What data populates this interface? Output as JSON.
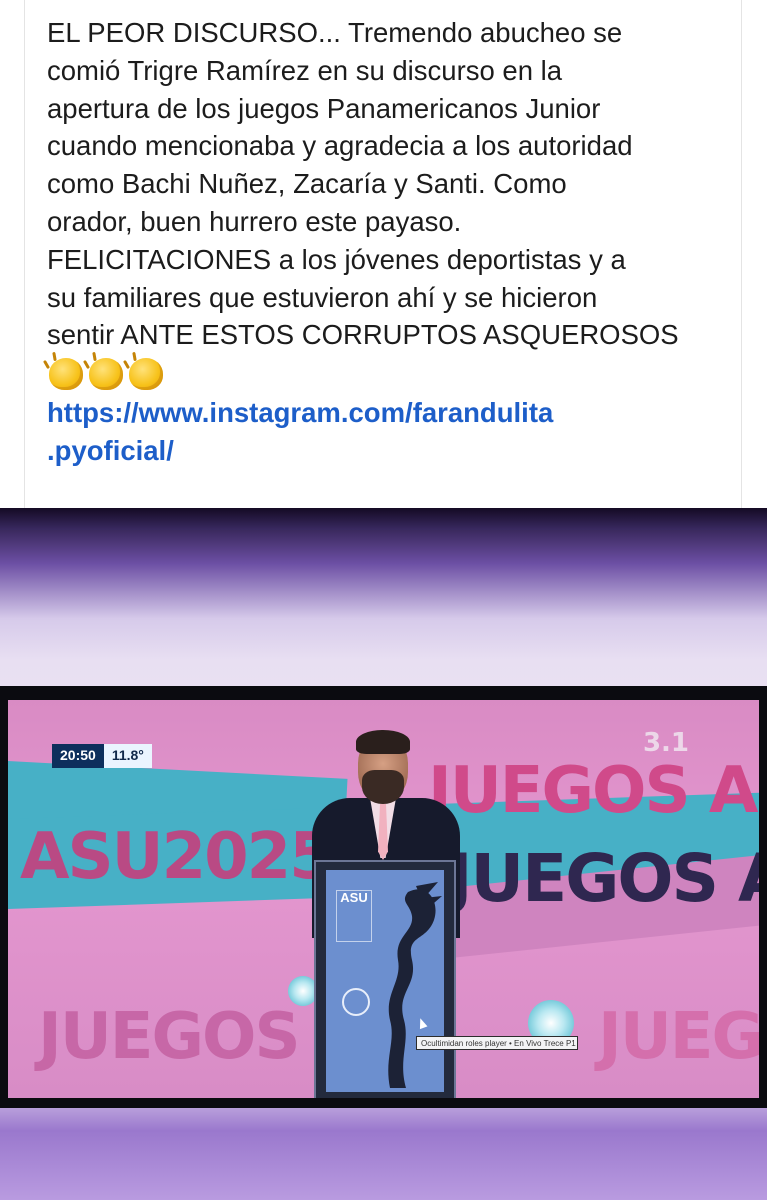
{
  "post": {
    "text_lines": [
      "EL PEOR DISCURSO... Tremendo abucheo se",
      "comió Trigre Ramírez en su discurso en la",
      "apertura de los juegos Panamericanos Junior",
      "cuando mencionaba y agradecia a los autoridad",
      "como Bachi Nuñez, Zacaría y Santi. Como",
      "orador, buen hurrero este payaso.",
      "FELICITACIONES a los jóvenes deportistas y a",
      "su familiares que estuvieron ahí y se hicieron",
      "sentir ANTE ESTOS CORRUPTOS ASQUEROSOS"
    ],
    "emoji_icons": [
      "clapping-hands-icon",
      "clapping-hands-icon",
      "clapping-hands-icon"
    ],
    "link_lines": [
      "https://www.instagram.com/farandulita",
      ".pyoficial/"
    ],
    "colors": {
      "text": "#1c1c1c",
      "link": "#1d5ec9"
    }
  },
  "photo": {
    "hud": {
      "time": "20:50",
      "temperature": "11.8°"
    },
    "channel_badge": "3.1",
    "backdrop_words": {
      "top_right": "JUEGOS ASU",
      "left": "ASU2025",
      "middle_right": "JUEGOS ASU",
      "bottom_left": "JUEGOS ASI",
      "bottom_right": "JUEG"
    },
    "podium_logo": "ASU",
    "ticker_text": "Ocultimidan roles player • En Vivo Trece P1",
    "colors": {
      "backdrop_pink": "#e497cf",
      "banner_blue": "#47b0c6",
      "hud_time_bg": "#0d2f5c"
    }
  }
}
